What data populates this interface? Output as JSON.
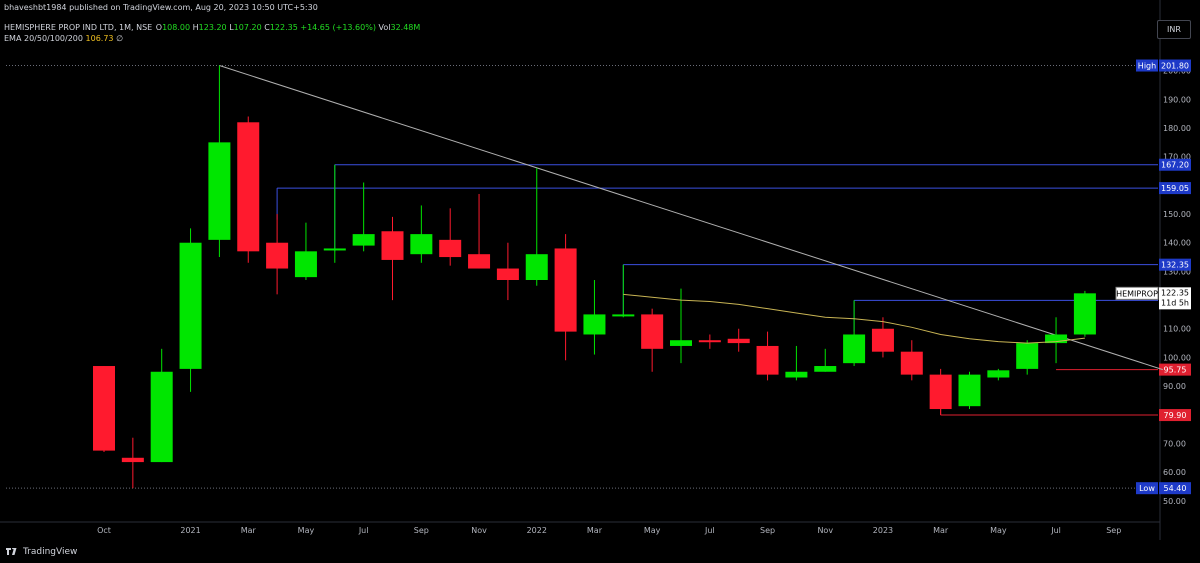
{
  "header": {
    "published_line": "bhaveshbt1984 published on TradingView.com, Aug 20, 2023 10:50 UTC+5:30",
    "symbol_line": "HEMISPHERE PROP IND LTD, 1M, NSE",
    "open_label": "O",
    "open_value": "108.00",
    "high_label": "H",
    "high_value": "123.20",
    "low_label": "L",
    "low_value": "107.20",
    "close_label": "C",
    "close_value": "122.35",
    "change_value": "+14.65 (+13.60%)",
    "vol_label": "Vol",
    "vol_value": "32.48M",
    "ema_label": "EMA 20/50/100/200",
    "ema_value": "106.73",
    "ema_extra": "∅"
  },
  "currency_button": "INR",
  "footer": {
    "brand": "TradingView"
  },
  "colors": {
    "up": "#00e600",
    "down": "#ff1a2e",
    "ema": "#c8b454",
    "trendline": "#b0b0b0",
    "resistance": "#3b4fe0",
    "support": "#e02030",
    "bg": "#000000",
    "axis_text": "#b2b5be"
  },
  "chart_data": {
    "type": "candlestick",
    "interval": "1M",
    "ylim": [
      44,
      210
    ],
    "y_ticks": [
      50,
      60,
      70,
      80,
      90,
      100,
      110,
      120,
      130,
      140,
      150,
      160,
      170,
      180,
      190,
      200
    ],
    "x_tick_labels": [
      "Oct",
      "2021",
      "Mar",
      "May",
      "Jul",
      "Sep",
      "Nov",
      "2022",
      "Mar",
      "May",
      "Jul",
      "Sep",
      "Nov",
      "2023",
      "Mar",
      "May",
      "Jul",
      "Sep"
    ],
    "x_tick_months": [
      "2020-10",
      "2021-01",
      "2021-03",
      "2021-05",
      "2021-07",
      "2021-09",
      "2021-11",
      "2022-01",
      "2022-03",
      "2022-05",
      "2022-07",
      "2022-09",
      "2022-11",
      "2023-01",
      "2023-03",
      "2023-05",
      "2023-07",
      "2023-09"
    ],
    "candles": [
      {
        "t": "2020-10",
        "o": 97,
        "h": 97,
        "l": 67,
        "c": 67.5
      },
      {
        "t": "2020-11",
        "o": 65,
        "h": 72,
        "l": 54.4,
        "c": 63.5
      },
      {
        "t": "2020-12",
        "o": 63.5,
        "h": 103,
        "l": 63.5,
        "c": 95
      },
      {
        "t": "2021-01",
        "o": 96,
        "h": 145,
        "l": 88,
        "c": 140
      },
      {
        "t": "2021-02",
        "o": 141,
        "h": 201.8,
        "l": 135,
        "c": 175
      },
      {
        "t": "2021-03",
        "o": 182,
        "h": 184,
        "l": 133,
        "c": 137
      },
      {
        "t": "2021-04",
        "o": 140,
        "h": 150,
        "l": 122,
        "c": 131
      },
      {
        "t": "2021-05",
        "o": 128,
        "h": 147,
        "l": 127,
        "c": 137
      },
      {
        "t": "2021-06",
        "o": 137.5,
        "h": 167.2,
        "l": 133,
        "c": 138
      },
      {
        "t": "2021-07",
        "o": 139,
        "h": 161,
        "l": 137,
        "c": 143
      },
      {
        "t": "2021-08",
        "o": 144,
        "h": 149,
        "l": 120,
        "c": 134
      },
      {
        "t": "2021-09",
        "o": 136,
        "h": 153,
        "l": 133,
        "c": 143
      },
      {
        "t": "2021-10",
        "o": 141,
        "h": 152,
        "l": 132,
        "c": 135
      },
      {
        "t": "2021-11",
        "o": 136,
        "h": 157,
        "l": 131,
        "c": 131
      },
      {
        "t": "2021-12",
        "o": 131,
        "h": 140,
        "l": 120,
        "c": 127
      },
      {
        "t": "2022-01",
        "o": 127,
        "h": 166,
        "l": 125,
        "c": 136
      },
      {
        "t": "2022-02",
        "o": 138,
        "h": 143,
        "l": 99,
        "c": 109
      },
      {
        "t": "2022-03",
        "o": 108,
        "h": 127,
        "l": 101,
        "c": 115
      },
      {
        "t": "2022-04",
        "o": 115,
        "h": 132.35,
        "l": 114,
        "c": 115
      },
      {
        "t": "2022-05",
        "o": 115,
        "h": 117,
        "l": 95,
        "c": 103
      },
      {
        "t": "2022-06",
        "o": 104,
        "h": 124,
        "l": 98,
        "c": 106
      },
      {
        "t": "2022-07",
        "o": 106,
        "h": 108,
        "l": 103,
        "c": 105.5
      },
      {
        "t": "2022-08",
        "o": 106.5,
        "h": 110,
        "l": 102,
        "c": 105
      },
      {
        "t": "2022-09",
        "o": 104,
        "h": 109,
        "l": 92,
        "c": 94
      },
      {
        "t": "2022-10",
        "o": 93,
        "h": 104,
        "l": 92,
        "c": 95
      },
      {
        "t": "2022-11",
        "o": 95,
        "h": 103,
        "l": 95,
        "c": 97
      },
      {
        "t": "2022-12",
        "o": 98,
        "h": 119.9,
        "l": 97,
        "c": 108
      },
      {
        "t": "2022-01b",
        "o": 110,
        "h": 114,
        "l": 100,
        "c": 102
      },
      {
        "t": "2023-02",
        "o": 102,
        "h": 106,
        "l": 92,
        "c": 94
      },
      {
        "t": "2023-03",
        "o": 94,
        "h": 96,
        "l": 79.9,
        "c": 82
      },
      {
        "t": "2023-04",
        "o": 83,
        "h": 95,
        "l": 82,
        "c": 94
      },
      {
        "t": "2023-05",
        "o": 93,
        "h": 96,
        "l": 92,
        "c": 95.5
      },
      {
        "t": "2023-06",
        "o": 96,
        "h": 106,
        "l": 94,
        "c": 105
      },
      {
        "t": "2023-07",
        "o": 105,
        "h": 114,
        "l": 98,
        "c": 108
      },
      {
        "t": "2023-08",
        "o": 108,
        "h": 123.2,
        "l": 107.2,
        "c": 122.35
      }
    ],
    "ema_line": [
      {
        "i": 18,
        "v": 122
      },
      {
        "i": 19,
        "v": 121
      },
      {
        "i": 20,
        "v": 120
      },
      {
        "i": 21,
        "v": 119.5
      },
      {
        "i": 22,
        "v": 118.5
      },
      {
        "i": 23,
        "v": 117
      },
      {
        "i": 24,
        "v": 115.5
      },
      {
        "i": 25,
        "v": 114
      },
      {
        "i": 26,
        "v": 113.5
      },
      {
        "i": 27,
        "v": 112.5
      },
      {
        "i": 28,
        "v": 110.5
      },
      {
        "i": 29,
        "v": 108
      },
      {
        "i": 30,
        "v": 106.5
      },
      {
        "i": 31,
        "v": 105.5
      },
      {
        "i": 32,
        "v": 105
      },
      {
        "i": 33,
        "v": 105.5
      },
      {
        "i": 34,
        "v": 106.73
      }
    ],
    "trendline": {
      "from": {
        "i": 4,
        "v": 201.8
      },
      "to": {
        "i": 36.7,
        "v": 95.75
      }
    },
    "horizontal_levels": [
      {
        "value": 201.8,
        "label": "High",
        "price": "201.80",
        "style": "dotted"
      },
      {
        "value": 167.2,
        "from_i": 8,
        "price": "167.20",
        "style": "resistance"
      },
      {
        "value": 159.05,
        "from_i": 6,
        "price": "159.05",
        "style": "resistance"
      },
      {
        "value": 132.35,
        "from_i": 18,
        "price": "132.35",
        "style": "resistance"
      },
      {
        "value": 119.9,
        "from_i": 26,
        "price": "119.90",
        "style": "resistance"
      },
      {
        "value": 95.75,
        "from_i": 33,
        "price": "95.75",
        "style": "support"
      },
      {
        "value": 79.9,
        "from_i": 29,
        "price": "79.90",
        "style": "support"
      },
      {
        "value": 54.4,
        "label": "Low",
        "price": "54.40",
        "style": "dotted"
      }
    ],
    "last_price": {
      "label": "HEMIPROP",
      "price": "122.35",
      "countdown": "11d 5h",
      "value": 122.35
    }
  }
}
